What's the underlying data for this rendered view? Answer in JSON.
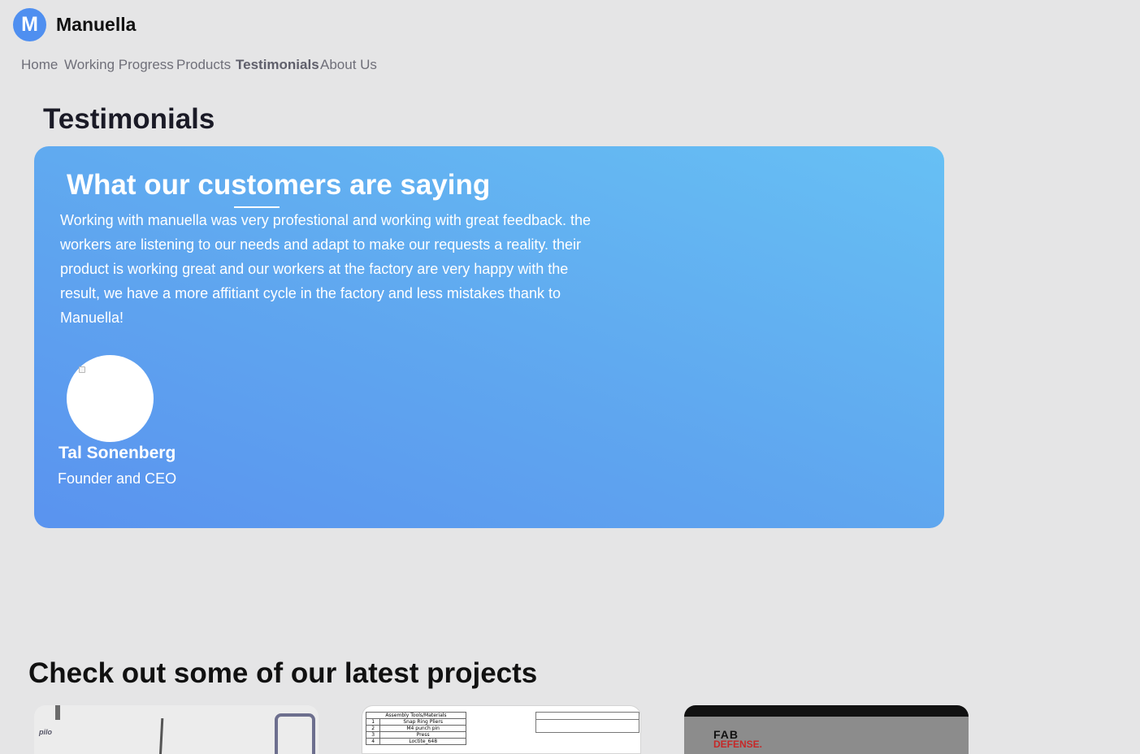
{
  "brand": {
    "logo_letter": "M",
    "name": "Manuella",
    "accent_color": "#4f8ff0"
  },
  "nav": {
    "items": [
      {
        "label": "Home",
        "active": false
      },
      {
        "label": "Working Progress",
        "active": false
      },
      {
        "label": "Products",
        "active": false
      },
      {
        "label": "Testimonials",
        "active": true
      },
      {
        "label": "About Us",
        "active": false
      }
    ]
  },
  "testimonials": {
    "section_title": "Testimonials",
    "card_heading": "What our customers are saying",
    "quote": "Working with manuella was very profestional and working with great feedback. the workers are listening to our needs and adapt to make our requests a reality. their product is working great and our workers at the factory are very happy with the result, we have a more affitiant cycle in the factory and less mistakes thank to Manuella!",
    "person_name": "Tal Sonenberg",
    "person_role": "Founder and CEO",
    "card_gradient": [
      "#5a93ef",
      "#67c0f4"
    ]
  },
  "projects": {
    "title": "Check out some of our latest projects",
    "thumb_1_logo": "pilo",
    "thumb_2_table": {
      "header": "Assembly Tools/Materials",
      "rows": [
        [
          "1",
          "Snap Ring Pliers"
        ],
        [
          "2",
          "M4 punch pin"
        ],
        [
          "3",
          "Press"
        ],
        [
          "4",
          "Loctite_648"
        ]
      ]
    },
    "thumb_3_logo": {
      "line1": "FAB",
      "line2": "DEFENSE."
    }
  }
}
